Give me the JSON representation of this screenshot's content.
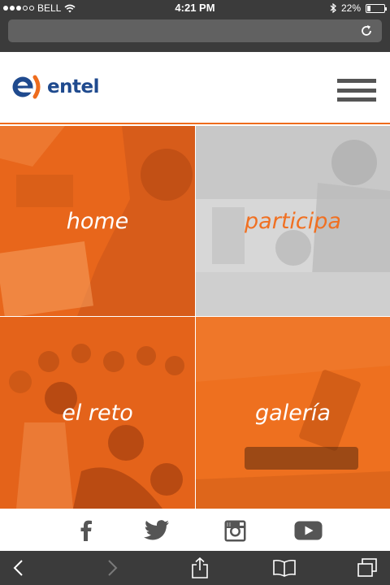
{
  "status_bar": {
    "carrier": "BELL",
    "time": "4:21 PM",
    "battery": "22%",
    "battery_level": 0.22,
    "signal_bars_filled": 3,
    "signal_bars_total": 5,
    "icons": [
      "wifi-icon",
      "bluetooth-icon",
      "battery-icon"
    ]
  },
  "address_bar": {
    "url": "",
    "icons": [
      "reload-icon"
    ]
  },
  "header": {
    "logo_text": "entel",
    "icons": [
      "entel-logo-icon",
      "hamburger-menu-icon"
    ]
  },
  "tiles": [
    {
      "label": "home",
      "color": "#e8661b"
    },
    {
      "label": "participa",
      "color": "#f07022"
    },
    {
      "label": "el reto",
      "color": "#e4631a"
    },
    {
      "label": "galería",
      "color": "#ee701f"
    }
  ],
  "social": {
    "icons": [
      "facebook-icon",
      "twitter-icon",
      "instagram-icon",
      "youtube-icon"
    ]
  },
  "toolbar": {
    "icons": [
      "back-icon",
      "forward-icon",
      "share-icon",
      "bookmarks-icon",
      "tabs-icon"
    ]
  },
  "colors": {
    "brand_orange": "#ee6c1d",
    "brand_blue": "#1f4a8e",
    "chrome_dark": "#3b3b3b",
    "icon_gray": "#555555"
  }
}
